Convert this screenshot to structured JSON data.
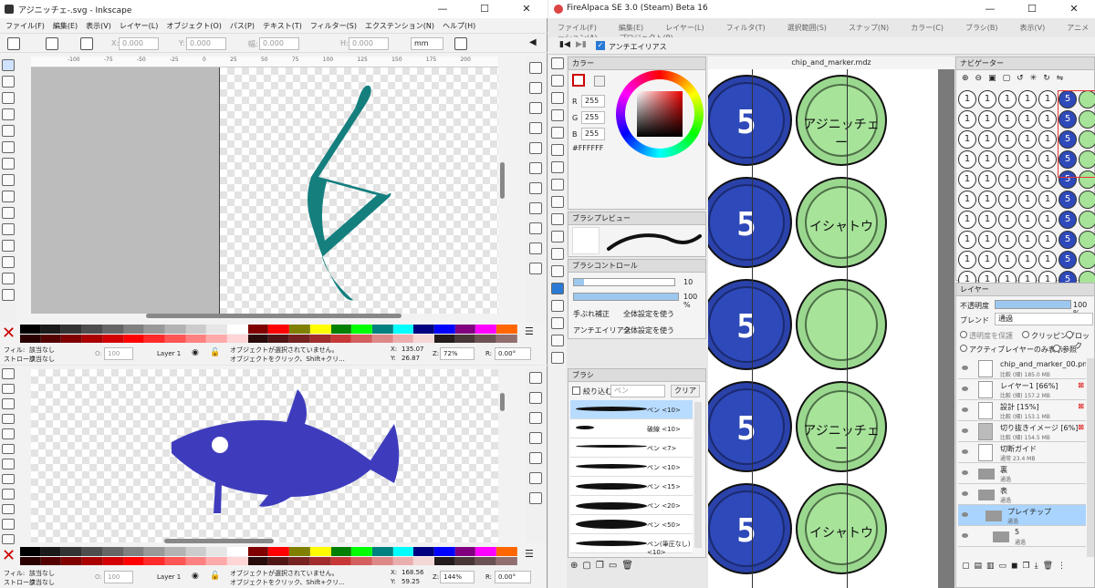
{
  "inkscape_top": {
    "title": "アジニッチェ-.svg - Inkscape",
    "menu": [
      "ファイル(F)",
      "編集(E)",
      "表示(V)",
      "レイヤー(L)",
      "オブジェクト(O)",
      "パス(P)",
      "テキスト(T)",
      "フィルター(S)",
      "エクステンション(N)",
      "ヘルプ(H)"
    ],
    "toolbar": {
      "x_label": "X:",
      "x_value": "0.000",
      "y_label": "Y:",
      "y_value": "0.000",
      "w_label": "幅:",
      "w_value": "0.000",
      "h_label": "H:",
      "h_value": "0.000",
      "unit": "mm"
    },
    "ruler": [
      "-100",
      "-75",
      "-50",
      "-25",
      "0",
      "25",
      "50",
      "75",
      "100",
      "125",
      "150",
      "175",
      "200"
    ],
    "status": {
      "fill_label": "フィル:",
      "fill_value": "該当なし",
      "stroke_label": "ストローク:",
      "stroke_value": "該当なし",
      "opacity_label": "O:",
      "opacity": "100",
      "layer": "Layer 1",
      "msg1": "オブジェクトが選択されていません。",
      "msg2": "オブジェクトをクリック、Shift+クリ...",
      "x_label": "X:",
      "x": "135.07",
      "y_label": "Y:",
      "y": "26.87",
      "zoom_label": "Z:",
      "zoom": "72%",
      "rot_label": "R:",
      "rot": "0.00°"
    }
  },
  "inkscape_bottom": {
    "status": {
      "fill_label": "フィル:",
      "fill_value": "該当なし",
      "stroke_label": "ストローク:",
      "stroke_value": "該当なし",
      "opacity_label": "O:",
      "opacity": "100",
      "layer": "Layer 1",
      "msg1": "オブジェクトが選択されていません。",
      "msg2": "オブジェクトをクリック、Shift+クリ...",
      "x_label": "X:",
      "x": "168.56",
      "y_label": "Y:",
      "y": "59.25",
      "zoom_label": "Z:",
      "zoom": "144%",
      "rot_label": "R:",
      "rot": "0.00°"
    }
  },
  "palette": [
    "#000000",
    "#1a1a1a",
    "#333333",
    "#4d4d4d",
    "#666666",
    "#808080",
    "#999999",
    "#b3b3b3",
    "#cccccc",
    "#e6e6e6",
    "#ffffff",
    "#800000",
    "#ff0000",
    "#808000",
    "#ffff00",
    "#008000",
    "#00ff00",
    "#008080",
    "#00ffff",
    "#000080",
    "#0000ff",
    "#800080",
    "#ff00ff",
    "#ff6600"
  ],
  "palette2": [
    "#2b0000",
    "#550000",
    "#800000",
    "#aa0000",
    "#d40000",
    "#ff0000",
    "#ff2a2a",
    "#ff5555",
    "#ff8080",
    "#ffaaaa",
    "#ffd5d5",
    "#280b0b",
    "#501616",
    "#782121",
    "#a02c2c",
    "#c83737",
    "#d35f5f",
    "#de8787",
    "#e9afaf",
    "#f4d7d7",
    "#241c1c",
    "#483737",
    "#6c5353",
    "#916f6f"
  ],
  "fa": {
    "title": "FireAlpaca SE 3.0 (Steam) Beta 16",
    "menu": [
      "ファイル(F)",
      "編集(E)",
      "レイヤー(L)",
      "フィルタ(T)",
      "選択範囲(S)",
      "スナップ(N)",
      "カラー(C)",
      "ブラシ(B)",
      "表示(V)",
      "アニメーション(A)",
      "プロジェクト(P)"
    ],
    "antialias": "アンチエイリアス",
    "doc_tab": "chip_and_marker.mdz",
    "color": {
      "title": "カラー",
      "r_label": "R",
      "r": "255",
      "g_label": "G",
      "g": "255",
      "b_label": "B",
      "b": "255",
      "hex": "#FFFFFF"
    },
    "brush_preview": {
      "title": "ブラシプレビュー"
    },
    "brush_control": {
      "title": "ブラシコントロール",
      "size": "10",
      "opacity": "100 %",
      "stabilizer_label": "手ぶれ補正",
      "stabilizer": "全体設定を使う",
      "aa_label": "アンチエイリアス",
      "aa": "全体設定を使う"
    },
    "brush": {
      "title": "ブラシ",
      "filter_label": "絞り込む",
      "filter_placeholder": "ペン",
      "clear": "クリア",
      "items": [
        "ペン <10>",
        "破線 <10>",
        "ペン <7>",
        "ペン <10>",
        "ペン <15>",
        "ペン <20>",
        "ペン <50>",
        "ペン(筆圧なし) <10>"
      ]
    },
    "canvas": {
      "coins": [
        {
          "type": "blue",
          "text": "5"
        },
        {
          "type": "green",
          "text": "アジニッチェー"
        },
        {
          "type": "blue",
          "text": "5"
        },
        {
          "type": "green",
          "text": "イシャトウ"
        },
        {
          "type": "blue",
          "text": "5"
        },
        {
          "type": "green",
          "text": ""
        },
        {
          "type": "blue",
          "text": "5"
        },
        {
          "type": "green",
          "text": "アジニッチェー"
        },
        {
          "type": "blue",
          "text": "5"
        },
        {
          "type": "green",
          "text": "イシャトウ"
        }
      ]
    },
    "navigator": {
      "title": "ナビゲーター",
      "cells": [
        "1",
        "1",
        "1",
        "1",
        "1",
        "5",
        ""
      ]
    },
    "layer": {
      "title": "レイヤー",
      "opacity_label": "不透明度",
      "opacity": "100 %",
      "blend_label": "ブレンド",
      "blend": "通過",
      "protect": "透明度を保護",
      "clipping": "クリッピング",
      "lock": "ロック",
      "active_only": "アクティブレイヤーのみ表示",
      "ref": "参照",
      "items": [
        {
          "name": "chip_and_marker_00.png",
          "sub": "比較 (細) 185.0 MB"
        },
        {
          "name": "レイヤー1 [66%]",
          "sub": "比較 (細) 157.2 MB"
        },
        {
          "name": "設計 [15%]",
          "sub": "比較 (細) 153.1 MB"
        },
        {
          "name": "切り抜きイメージ [6%]",
          "sub": "比較 (細) 154.5 MB"
        },
        {
          "name": "切断ガイド",
          "sub": "通常 23.4 MB"
        },
        {
          "name": "裏",
          "sub": "通過"
        },
        {
          "name": "表",
          "sub": "通過"
        },
        {
          "name": "プレイチップ",
          "sub": "通過"
        },
        {
          "name": "5",
          "sub": "通過"
        }
      ]
    }
  }
}
